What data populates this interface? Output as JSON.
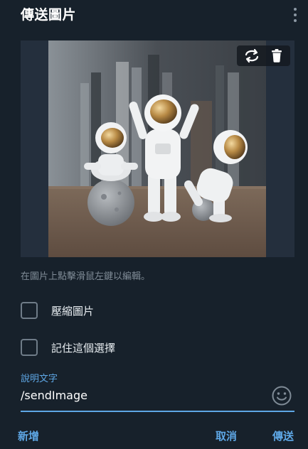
{
  "dialog": {
    "title": "傳送圖片",
    "hint": "在圖片上點擊滑鼠左鍵以編輯。",
    "options": [
      {
        "label": "壓縮圖片",
        "checked": false
      },
      {
        "label": "記住這個選擇",
        "checked": false
      }
    ],
    "caption": {
      "label": "說明文字",
      "value": "/sendImage"
    },
    "buttons": {
      "add": "新增",
      "cancel": "取消",
      "send": "傳送"
    }
  },
  "icons": {
    "menu": "more-vertical-icon",
    "replace": "replace-image-icon",
    "delete": "trash-icon",
    "emoji": "smiley-icon"
  },
  "colors": {
    "background": "#17212b",
    "accent": "#5ea7e5",
    "muted_text": "#7f8b96",
    "image_backdrop": "#242f3d"
  }
}
